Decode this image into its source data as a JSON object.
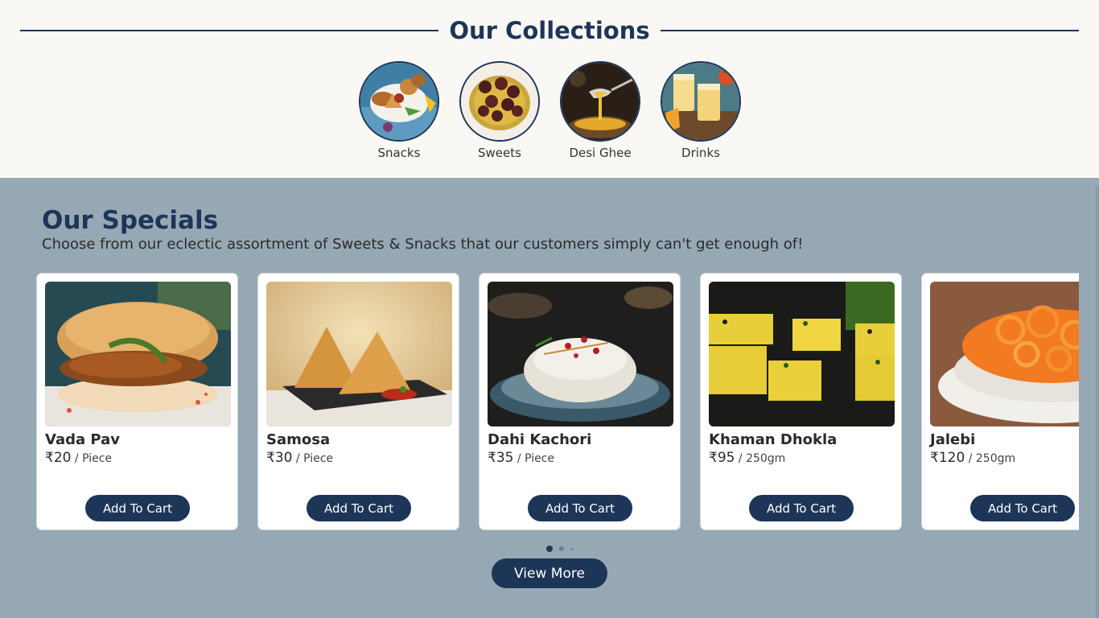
{
  "collections": {
    "title": "Our Collections",
    "items": [
      {
        "label": "Snacks",
        "image": "snacks-platter-photo"
      },
      {
        "label": "Sweets",
        "image": "gulab-jamun-photo"
      },
      {
        "label": "Desi Ghee",
        "image": "ghee-spoon-photo"
      },
      {
        "label": "Drinks",
        "image": "mango-lassi-photo"
      }
    ]
  },
  "specials": {
    "title": "Our Specials",
    "subtitle": "Choose from our eclectic assortment of Sweets & Snacks that our customers simply can't get enough of!",
    "products": [
      {
        "name": "Vada Pav",
        "price": "₹20",
        "unit": " / Piece",
        "button": "Add To Cart"
      },
      {
        "name": "Samosa",
        "price": "₹30",
        "unit": " / Piece",
        "button": "Add To Cart"
      },
      {
        "name": "Dahi Kachori",
        "price": "₹35",
        "unit": " / Piece",
        "button": "Add To Cart"
      },
      {
        "name": "Khaman Dhokla",
        "price": "₹95",
        "unit": " / 250gm",
        "button": "Add To Cart"
      },
      {
        "name": "Jalebi",
        "price": "₹120",
        "unit": " / 250gm",
        "button": "Add To Cart"
      }
    ],
    "view_more": "View More"
  },
  "colors": {
    "primary": "#1d3557",
    "section_bg": "#97a8b5",
    "page_bg": "#faf8f4"
  }
}
